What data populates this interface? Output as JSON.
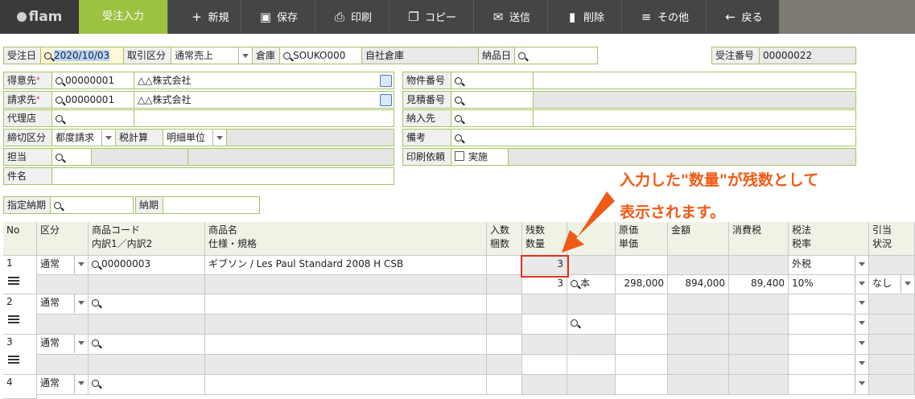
{
  "toolbar": {
    "logo": "flam",
    "active_tab": "受注入力",
    "buttons": [
      {
        "icon": "plus-icon",
        "label": "新規"
      },
      {
        "icon": "save-icon",
        "label": "保存"
      },
      {
        "icon": "print-icon",
        "label": "印刷"
      },
      {
        "icon": "copy-icon",
        "label": "コピー"
      },
      {
        "icon": "mail-icon",
        "label": "送信"
      },
      {
        "icon": "trash-icon",
        "label": "削除"
      },
      {
        "icon": "menu-icon",
        "label": "その他"
      },
      {
        "icon": "back-arrow-icon",
        "label": "戻る"
      }
    ]
  },
  "header": {
    "order_date_label": "受注日",
    "order_date": "2020/10/03",
    "trade_type_label": "取引区分",
    "trade_type": "通常売上",
    "warehouse_label": "倉庫",
    "warehouse_code": "SOUKO000",
    "warehouse_name": "自社倉庫",
    "delivery_date_label": "納品日",
    "delivery_date": "",
    "order_no_label": "受注番号",
    "order_no": "00000022"
  },
  "customer": {
    "customer_label": "得意先",
    "customer_code": "00000001",
    "customer_name": "△△株式会社",
    "billing_label": "請求先",
    "billing_code": "00000001",
    "billing_name": "△△株式会社",
    "agent_label": "代理店",
    "closing_label": "締切区分",
    "closing_value": "都度請求",
    "tax_calc_label": "税計算",
    "tax_calc_value": "明細単位",
    "person_label": "担当",
    "subject_label": "件名"
  },
  "right_panel": {
    "property_no_label": "物件番号",
    "estimate_no_label": "見積番号",
    "ship_to_label": "納入先",
    "remarks_label": "備考",
    "print_request_label": "印刷依頼",
    "print_request_option": "実施"
  },
  "due": {
    "specified_due_label": "指定納期",
    "due_label": "納期"
  },
  "annotation": {
    "line1": "入力した\"数量\"が残数として",
    "line2": "表示されます。"
  },
  "grid": {
    "headers": {
      "no": "No",
      "kubun": "区分",
      "code1": "商品コード",
      "code2": "内訳1／内訳2",
      "name1": "商品名",
      "name2": "仕様・規格",
      "irisu1": "入数",
      "irisu2": "梱数",
      "zan1": "残数",
      "zan2": "数量",
      "genka1": "原価",
      "genka2": "単価",
      "kingaku": "金額",
      "tax": "消費税",
      "taxlaw1": "税法",
      "taxlaw2": "税率",
      "hikiate1": "引当",
      "hikiate2": "状況"
    },
    "rows": [
      {
        "no": "1",
        "kubun": "通常",
        "code": "00000003",
        "name": "ギブソン / Les Paul Standard 2008 H CSB",
        "remaining": "3",
        "quantity": "3",
        "unit_name": "本",
        "unit_price": "298,000",
        "amount": "894,000",
        "tax": "89,400",
        "tax_method": "外税",
        "tax_rate": "10%",
        "allocation": "なし"
      },
      {
        "no": "2",
        "kubun": "通常"
      },
      {
        "no": "3",
        "kubun": "通常"
      },
      {
        "no": "4",
        "kubun": "通常"
      }
    ]
  },
  "colors": {
    "accent": "#9dc141",
    "toolbar": "#454545",
    "annotation": "#f05a14",
    "highlight": "#e0301e",
    "border": "#a4c463"
  }
}
